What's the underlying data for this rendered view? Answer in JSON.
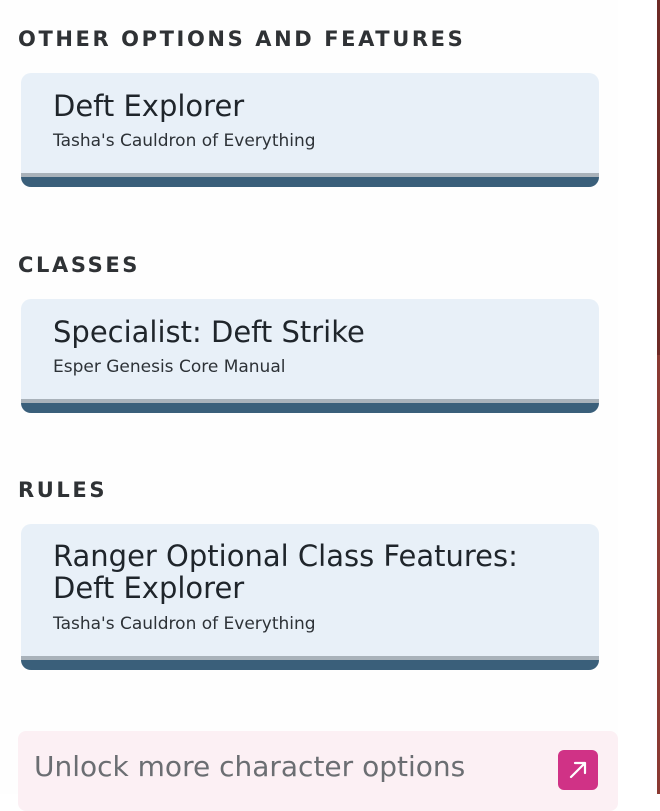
{
  "sections": [
    {
      "heading": "OTHER OPTIONS AND FEATURES",
      "card": {
        "title_lines": [
          "Deft Explorer"
        ],
        "source": "Tasha's Cauldron of Everything"
      }
    },
    {
      "heading": "CLASSES",
      "card": {
        "title_lines": [
          "Specialist: Deft Strike"
        ],
        "source": "Esper Genesis Core Manual"
      }
    },
    {
      "heading": "RULES",
      "card": {
        "title_lines": [
          "Ranger Optional Class Features:",
          "Deft Explorer"
        ],
        "source": "Tasha's Cauldron of Everything"
      }
    }
  ],
  "promo": {
    "text": "Unlock more character options",
    "icon": "external-link-icon",
    "icon_color": "#d03286"
  },
  "colors": {
    "card_bg": "#e8f0f8",
    "card_stripe": "#3a5f7a",
    "promo_bg": "#fcf0f4"
  }
}
